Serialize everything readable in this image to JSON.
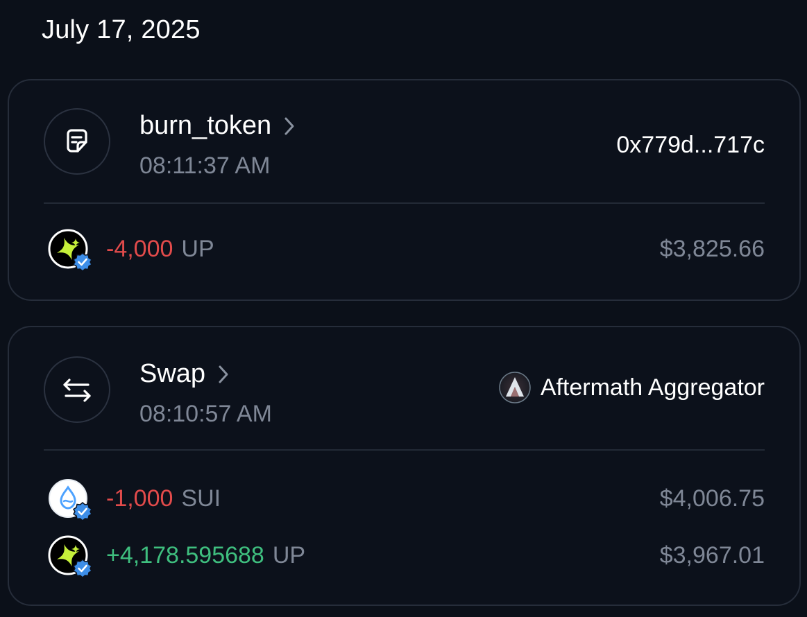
{
  "date": "July 17, 2025",
  "transactions": [
    {
      "title": "burn_token",
      "time": "08:11:37 AM",
      "counterparty": "0x779d...717c",
      "assets": [
        {
          "amount": "-4,000",
          "symbol": "UP",
          "usd": "$3,825.66",
          "direction": "out",
          "icon": "up-token-icon"
        }
      ]
    },
    {
      "title": "Swap",
      "time": "08:10:57 AM",
      "counterparty": "Aftermath Aggregator",
      "assets": [
        {
          "amount": "-1,000",
          "symbol": "SUI",
          "usd": "$4,006.75",
          "direction": "out",
          "icon": "sui-token-icon"
        },
        {
          "amount": "+4,178.595688",
          "symbol": "UP",
          "usd": "$3,967.01",
          "direction": "in",
          "icon": "up-token-icon"
        }
      ]
    }
  ],
  "colors": {
    "background": "#0b1019",
    "card_border": "#262d3a",
    "negative": "#e24b4b",
    "positive": "#3fbf7f",
    "muted": "#7f8796",
    "verified_badge": "#3d8ee8",
    "up_token_accent": "#c6f03a"
  }
}
